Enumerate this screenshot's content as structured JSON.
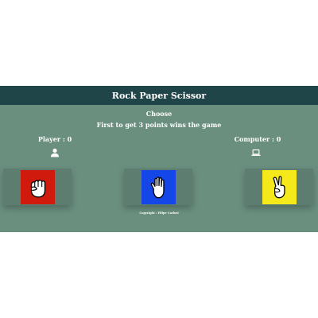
{
  "header": {
    "title": "Rock Paper Scissor"
  },
  "game": {
    "choose_label": "Choose",
    "rule_text": "First to get 3 points wins the game",
    "player_score_label": "Player : 0",
    "computer_score_label": "Computer : 0"
  },
  "choices": [
    {
      "name": "rock",
      "color": "#d11a0e",
      "icon": "fist-hand-icon"
    },
    {
      "name": "paper",
      "color": "#1546e8",
      "icon": "open-hand-icon"
    },
    {
      "name": "scissor",
      "color": "#f5e81b",
      "icon": "peace-hand-icon"
    }
  ],
  "footer": {
    "copyright": "Copyright : Filipe Carlosi"
  },
  "colors": {
    "header_bg": "#1f4548",
    "app_bg": "#6a8f7f",
    "card_bg": "#5c7d70"
  }
}
